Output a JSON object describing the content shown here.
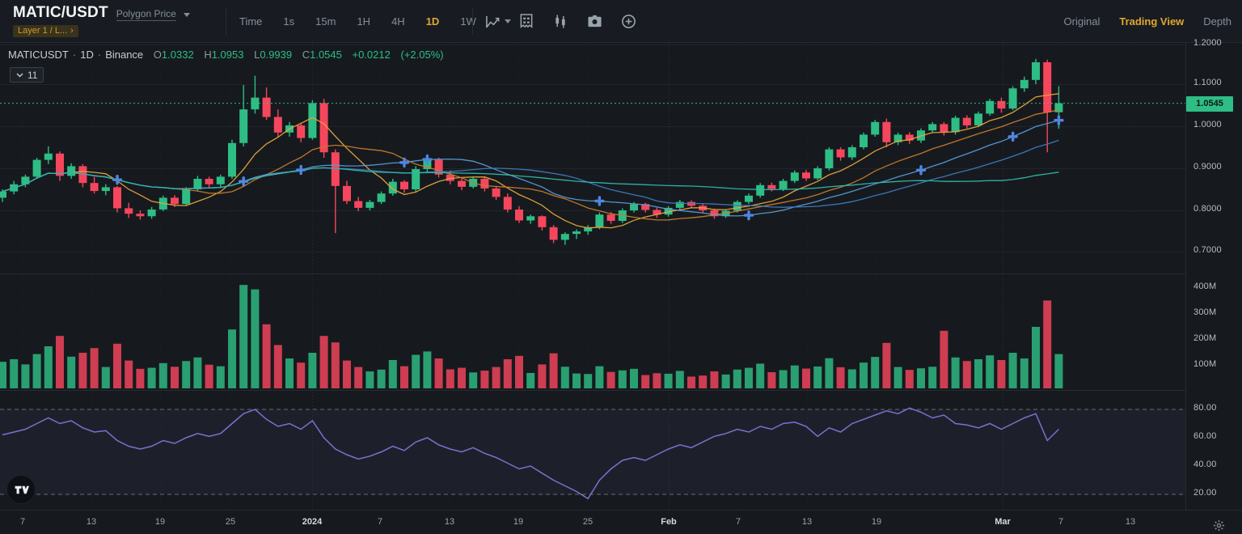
{
  "colors": {
    "background": "#161a1e",
    "accent_gold": "#e0a82e",
    "green": "#2ebd85",
    "red": "#f6465d",
    "text_primary": "#eaecef",
    "text_muted": "#848e9c",
    "axis_text": "#b7bdc6",
    "rsi_line": "#7d6fd0",
    "marker_blue": "#4f86e0",
    "ma_colors": [
      "#e8a33c",
      "#c97b2d",
      "#5a9ad8",
      "#3f7ac0",
      "#2fb9ac"
    ]
  },
  "header": {
    "symbol": "MATIC/USDT",
    "subtitle_link": "Polygon Price",
    "category_tag": "Layer 1 / L...",
    "category_tag_arrow": "›",
    "timeframes": [
      "Time",
      "1s",
      "15m",
      "1H",
      "4H",
      "1D",
      "1W"
    ],
    "active_timeframe": "1D",
    "toolbar_icons": [
      "line-chart-icon",
      "data-grid-icon",
      "candlestick-icon",
      "camera-icon",
      "plus-circle-icon"
    ],
    "view_tabs": [
      "Original",
      "Trading View",
      "Depth"
    ],
    "active_view_tab": "Trading View"
  },
  "legend": {
    "instrument": "MATICUSDT",
    "separator": "·",
    "interval": "1D",
    "exchange": "Binance",
    "open_label": "O",
    "open": "1.0332",
    "high_label": "H",
    "high": "1.0953",
    "low_label": "L",
    "low": "0.9939",
    "close_label": "C",
    "close": "1.0545",
    "change": "+0.0212",
    "change_pct": "(+2.05%)"
  },
  "indicators_badge": {
    "count": "11"
  },
  "axes": {
    "price": [
      [
        "1.2000",
        55
      ],
      [
        "1.1000",
        104
      ],
      [
        "1.0000",
        156
      ],
      [
        "0.9000",
        208
      ],
      [
        "0.8000",
        260
      ],
      [
        "0.7000",
        311
      ]
    ],
    "last_price": "1.0545",
    "volume": [
      [
        "400M",
        356
      ],
      [
        "300M",
        388
      ],
      [
        "200M",
        420
      ],
      [
        "100M",
        452
      ]
    ],
    "rsi": [
      [
        "80.00",
        506
      ],
      [
        "60.00",
        541
      ],
      [
        "40.00",
        576
      ],
      [
        "20.00",
        611
      ]
    ],
    "time": [
      [
        "7",
        28,
        0
      ],
      [
        "13",
        113,
        0
      ],
      [
        "19",
        198,
        0
      ],
      [
        "25",
        285,
        0
      ],
      [
        "2024",
        386,
        1
      ],
      [
        "7",
        470,
        0
      ],
      [
        "13",
        556,
        0
      ],
      [
        "19",
        641,
        0
      ],
      [
        "25",
        727,
        0
      ],
      [
        "Feb",
        827,
        1
      ],
      [
        "7",
        913,
        0
      ],
      [
        "13",
        998,
        0
      ],
      [
        "19",
        1084,
        0
      ],
      [
        "Mar",
        1240,
        1
      ],
      [
        "7",
        1312,
        0
      ],
      [
        "13",
        1398,
        0
      ]
    ]
  },
  "chart_data": {
    "type": "candlestick+volume+line",
    "title": "MATICUSDT 1D Binance",
    "panes": [
      "price",
      "volume",
      "rsi"
    ],
    "price_ylim": [
      0.65,
      1.2
    ],
    "volume_ylim_millions": [
      0,
      440
    ],
    "rsi_ylim": [
      10,
      94
    ],
    "rsi_bands": [
      80,
      20
    ],
    "last_price": 1.0545,
    "ma_windows": [
      7,
      14,
      21,
      30,
      60
    ],
    "marker_indices": [
      10,
      21,
      26,
      35,
      37,
      52,
      65,
      80,
      88,
      92
    ],
    "candles_ohlcv": [
      [
        0.83,
        0.85,
        0.82,
        0.845,
        115
      ],
      [
        0.845,
        0.87,
        0.838,
        0.862,
        125
      ],
      [
        0.862,
        0.885,
        0.855,
        0.88,
        105
      ],
      [
        0.88,
        0.925,
        0.875,
        0.92,
        145
      ],
      [
        0.92,
        0.952,
        0.91,
        0.935,
        175
      ],
      [
        0.935,
        0.94,
        0.87,
        0.882,
        215
      ],
      [
        0.882,
        0.912,
        0.875,
        0.905,
        135
      ],
      [
        0.905,
        0.91,
        0.855,
        0.865,
        150
      ],
      [
        0.865,
        0.88,
        0.84,
        0.846,
        168
      ],
      [
        0.846,
        0.862,
        0.836,
        0.855,
        95
      ],
      [
        0.855,
        0.858,
        0.795,
        0.805,
        185
      ],
      [
        0.805,
        0.818,
        0.782,
        0.792,
        120
      ],
      [
        0.792,
        0.8,
        0.778,
        0.786,
        88
      ],
      [
        0.786,
        0.808,
        0.78,
        0.802,
        92
      ],
      [
        0.802,
        0.835,
        0.798,
        0.83,
        110
      ],
      [
        0.83,
        0.836,
        0.808,
        0.815,
        96
      ],
      [
        0.815,
        0.855,
        0.812,
        0.85,
        118
      ],
      [
        0.85,
        0.882,
        0.845,
        0.875,
        132
      ],
      [
        0.875,
        0.88,
        0.852,
        0.862,
        104
      ],
      [
        0.862,
        0.885,
        0.855,
        0.88,
        98
      ],
      [
        0.88,
        0.968,
        0.875,
        0.96,
        240
      ],
      [
        0.96,
        1.098,
        0.952,
        1.04,
        412
      ],
      [
        1.04,
        1.12,
        1.03,
        1.068,
        395
      ],
      [
        1.068,
        1.092,
        1.015,
        1.022,
        260
      ],
      [
        1.022,
        1.04,
        0.975,
        0.985,
        180
      ],
      [
        0.985,
        1.01,
        0.975,
        1.002,
        128
      ],
      [
        1.002,
        1.008,
        0.962,
        0.972,
        112
      ],
      [
        0.972,
        1.062,
        0.968,
        1.055,
        150
      ],
      [
        1.055,
        1.065,
        0.925,
        0.938,
        215
      ],
      [
        0.938,
        0.945,
        0.746,
        0.858,
        190
      ],
      [
        0.858,
        0.87,
        0.815,
        0.822,
        120
      ],
      [
        0.822,
        0.832,
        0.798,
        0.806,
        95
      ],
      [
        0.806,
        0.825,
        0.8,
        0.82,
        78
      ],
      [
        0.82,
        0.845,
        0.815,
        0.84,
        85
      ],
      [
        0.84,
        0.875,
        0.835,
        0.868,
        122
      ],
      [
        0.868,
        0.872,
        0.842,
        0.85,
        98
      ],
      [
        0.85,
        0.905,
        0.845,
        0.898,
        142
      ],
      [
        0.898,
        0.928,
        0.89,
        0.92,
        155
      ],
      [
        0.92,
        0.925,
        0.878,
        0.885,
        128
      ],
      [
        0.885,
        0.895,
        0.862,
        0.87,
        86
      ],
      [
        0.87,
        0.878,
        0.848,
        0.856,
        92
      ],
      [
        0.856,
        0.88,
        0.852,
        0.875,
        74
      ],
      [
        0.875,
        0.88,
        0.845,
        0.852,
        81
      ],
      [
        0.852,
        0.858,
        0.825,
        0.832,
        95
      ],
      [
        0.832,
        0.84,
        0.795,
        0.802,
        125
      ],
      [
        0.802,
        0.81,
        0.77,
        0.776,
        138
      ],
      [
        0.776,
        0.79,
        0.768,
        0.786,
        72
      ],
      [
        0.786,
        0.788,
        0.752,
        0.76,
        105
      ],
      [
        0.76,
        0.765,
        0.722,
        0.73,
        148
      ],
      [
        0.73,
        0.748,
        0.718,
        0.744,
        96
      ],
      [
        0.744,
        0.755,
        0.732,
        0.75,
        70
      ],
      [
        0.75,
        0.765,
        0.742,
        0.76,
        68
      ],
      [
        0.76,
        0.795,
        0.755,
        0.79,
        98
      ],
      [
        0.79,
        0.796,
        0.768,
        0.775,
        76
      ],
      [
        0.775,
        0.805,
        0.77,
        0.8,
        82
      ],
      [
        0.8,
        0.82,
        0.795,
        0.815,
        88
      ],
      [
        0.815,
        0.818,
        0.795,
        0.801,
        64
      ],
      [
        0.801,
        0.806,
        0.782,
        0.79,
        71
      ],
      [
        0.79,
        0.81,
        0.785,
        0.806,
        69
      ],
      [
        0.806,
        0.825,
        0.8,
        0.82,
        80
      ],
      [
        0.82,
        0.824,
        0.805,
        0.811,
        58
      ],
      [
        0.811,
        0.815,
        0.795,
        0.8,
        62
      ],
      [
        0.8,
        0.804,
        0.78,
        0.786,
        78
      ],
      [
        0.786,
        0.803,
        0.782,
        0.799,
        66
      ],
      [
        0.799,
        0.824,
        0.795,
        0.82,
        85
      ],
      [
        0.82,
        0.84,
        0.815,
        0.835,
        92
      ],
      [
        0.835,
        0.865,
        0.83,
        0.86,
        108
      ],
      [
        0.86,
        0.866,
        0.845,
        0.851,
        75
      ],
      [
        0.851,
        0.875,
        0.846,
        0.87,
        83
      ],
      [
        0.87,
        0.895,
        0.865,
        0.89,
        101
      ],
      [
        0.89,
        0.896,
        0.87,
        0.876,
        89
      ],
      [
        0.876,
        0.905,
        0.872,
        0.9,
        97
      ],
      [
        0.9,
        0.95,
        0.895,
        0.945,
        129
      ],
      [
        0.945,
        0.95,
        0.918,
        0.926,
        94
      ],
      [
        0.926,
        0.955,
        0.92,
        0.95,
        86
      ],
      [
        0.95,
        0.985,
        0.945,
        0.98,
        112
      ],
      [
        0.98,
        1.015,
        0.975,
        1.01,
        134
      ],
      [
        1.01,
        1.018,
        0.95,
        0.962,
        188
      ],
      [
        0.962,
        0.985,
        0.955,
        0.98,
        95
      ],
      [
        0.98,
        0.986,
        0.958,
        0.966,
        84
      ],
      [
        0.966,
        0.995,
        0.96,
        0.99,
        90
      ],
      [
        0.99,
        1.01,
        0.985,
        1.005,
        96
      ],
      [
        1.005,
        1.01,
        0.978,
        0.986,
        235
      ],
      [
        0.986,
        1.025,
        0.98,
        1.02,
        132
      ],
      [
        1.02,
        1.026,
        0.995,
        1.002,
        118
      ],
      [
        1.002,
        1.035,
        0.998,
        1.03,
        125
      ],
      [
        1.03,
        1.065,
        1.025,
        1.06,
        140
      ],
      [
        1.06,
        1.068,
        1.032,
        1.042,
        122
      ],
      [
        1.042,
        1.095,
        1.038,
        1.09,
        150
      ],
      [
        1.09,
        1.118,
        1.082,
        1.11,
        128
      ],
      [
        1.11,
        1.16,
        1.1,
        1.152,
        250
      ],
      [
        1.152,
        1.158,
        0.938,
        1.033,
        352
      ],
      [
        1.0332,
        1.0953,
        0.9939,
        1.0545,
        145
      ]
    ],
    "rsi_values": [
      62,
      64,
      66,
      70,
      74,
      70,
      72,
      67,
      64,
      65,
      58,
      54,
      52,
      54,
      58,
      56,
      60,
      63,
      61,
      63,
      70,
      77,
      80,
      73,
      68,
      70,
      66,
      72,
      60,
      52,
      48,
      45,
      47,
      50,
      54,
      51,
      57,
      60,
      55,
      52,
      50,
      53,
      49,
      46,
      42,
      38,
      40,
      35,
      30,
      26,
      22,
      17,
      30,
      38,
      44,
      46,
      44,
      48,
      52,
      55,
      53,
      57,
      61,
      63,
      66,
      64,
      68,
      66,
      70,
      71,
      68,
      61,
      67,
      64,
      70,
      73,
      76,
      79,
      77,
      81,
      78,
      74,
      76,
      70,
      69,
      67,
      70,
      66,
      70,
      74,
      77,
      58,
      66
    ]
  }
}
